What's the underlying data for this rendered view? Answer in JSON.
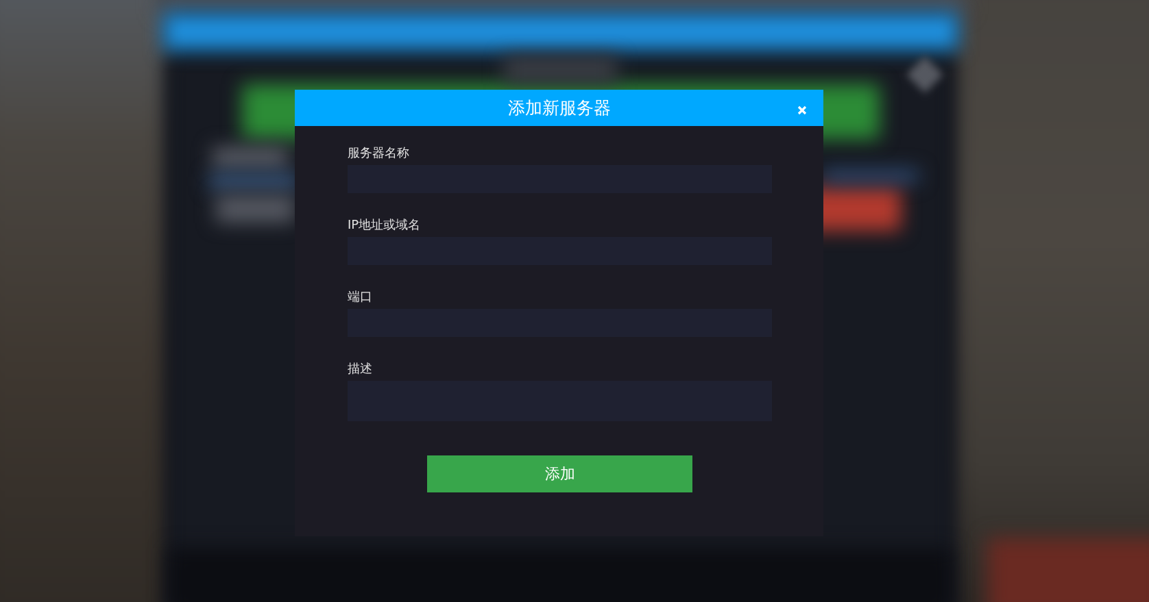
{
  "dialog": {
    "title": "添加新服务器",
    "fields": [
      {
        "label": "服务器名称",
        "kind": "input"
      },
      {
        "label": "IP地址或域名",
        "kind": "input"
      },
      {
        "label": "端口",
        "kind": "input"
      },
      {
        "label": "描述",
        "kind": "textarea"
      }
    ],
    "submit_button": "添加"
  }
}
